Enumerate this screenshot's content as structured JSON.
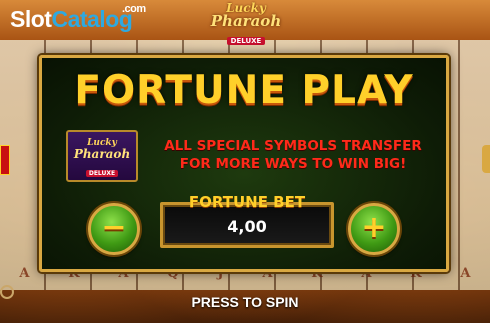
{
  "watermark": {
    "part1": "Slot",
    "part2": "Catalog",
    "suffix": ".com"
  },
  "game_logo": {
    "line1": "Lucky",
    "line2": "Pharaoh",
    "badge": "DELUXE"
  },
  "dialog": {
    "title": "FORTUNE PLAY",
    "thumbnail": {
      "line1": "Lucky",
      "line2": "Pharaoh",
      "badge": "DELUXE"
    },
    "description_line1": "ALL SPECIAL SYMBOLS TRANSFER",
    "description_line2": "FOR MORE WAYS TO WIN BIG!",
    "bet_label": "FORTUNE BET",
    "bet_value": "4,00",
    "minus_label": "−",
    "plus_label": "+"
  },
  "reel_symbols": [
    "A",
    "K",
    "A",
    "Q",
    "J",
    "A",
    "K",
    "A",
    "K",
    "A"
  ],
  "footer": {
    "press_to_spin": "PRESS TO SPIN"
  },
  "colors": {
    "title": "#ffd02a",
    "description": "#ff2a1a",
    "button": "#3f9a14",
    "frame": "#d9a842",
    "dialog_bg": "#0e1c06"
  }
}
